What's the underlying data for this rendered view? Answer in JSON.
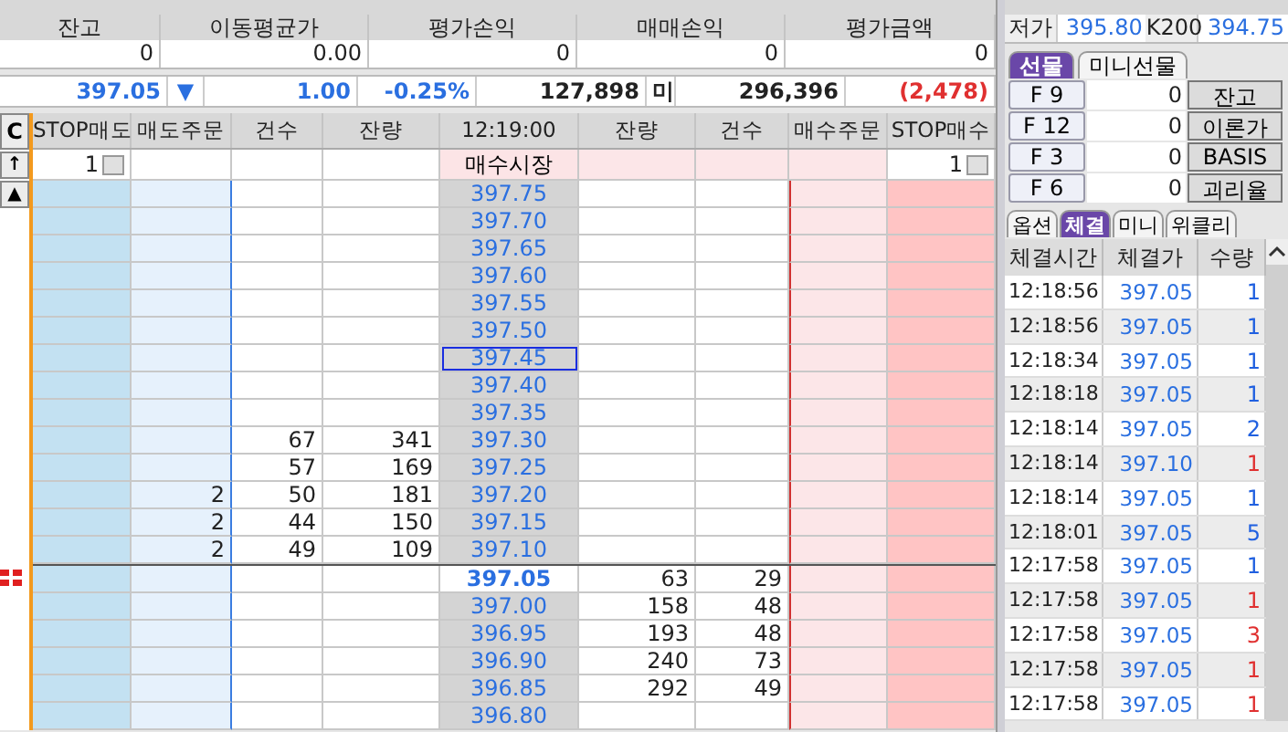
{
  "summary": {
    "headers": [
      "잔고",
      "이동평균가",
      "평가손익",
      "매매손익",
      "평가금액"
    ],
    "values": [
      "0",
      "0.00",
      "0",
      "0",
      "0"
    ]
  },
  "quote": {
    "price": "397.05",
    "direction": "▼",
    "change": "1.00",
    "rate": "-0.25%",
    "volume": "127,898",
    "label": "미",
    "open_interest": "296,396",
    "oi_change": "(2,478)"
  },
  "order_book": {
    "headers": [
      "C",
      "STOP매도",
      "매도주문",
      "건수",
      "잔량",
      "12:19:00",
      "잔량",
      "건수",
      "매수주문",
      "STOP매수"
    ],
    "market_row": {
      "button": "↑",
      "stop_sell": "1",
      "price": "매수시장",
      "stop_buy": "1"
    },
    "scroll_button": "▲",
    "rows": [
      {
        "price": "397.75",
        "selected": false,
        "current": false
      },
      {
        "price": "397.70",
        "selected": false,
        "current": false
      },
      {
        "price": "397.65",
        "selected": false,
        "current": false
      },
      {
        "price": "397.60",
        "selected": false,
        "current": false
      },
      {
        "price": "397.55",
        "selected": false,
        "current": false
      },
      {
        "price": "397.50",
        "selected": false,
        "current": false
      },
      {
        "price": "397.45",
        "selected": true,
        "current": false
      },
      {
        "price": "397.40",
        "selected": false,
        "current": false
      },
      {
        "price": "397.35",
        "selected": false,
        "current": false
      },
      {
        "sell_count": "67",
        "sell_qty": "341",
        "price": "397.30",
        "selected": false,
        "current": false
      },
      {
        "sell_count": "57",
        "sell_qty": "169",
        "price": "397.25",
        "selected": false,
        "current": false
      },
      {
        "sell_order": "2",
        "sell_count": "50",
        "sell_qty": "181",
        "price": "397.20",
        "selected": false,
        "current": false
      },
      {
        "sell_order": "2",
        "sell_count": "44",
        "sell_qty": "150",
        "price": "397.15",
        "selected": false,
        "current": false
      },
      {
        "sell_order": "2",
        "sell_count": "49",
        "sell_qty": "109",
        "price": "397.10",
        "selected": false,
        "current": false
      },
      {
        "price": "397.05",
        "buy_qty": "63",
        "buy_count": "29",
        "selected": false,
        "current": true
      },
      {
        "price": "397.00",
        "buy_qty": "158",
        "buy_count": "48",
        "selected": false,
        "current": false
      },
      {
        "price": "396.95",
        "buy_qty": "193",
        "buy_count": "48",
        "selected": false,
        "current": false
      },
      {
        "price": "396.90",
        "buy_qty": "240",
        "buy_count": "73",
        "selected": false,
        "current": false
      },
      {
        "price": "396.85",
        "buy_qty": "292",
        "buy_count": "49",
        "selected": false,
        "current": false
      },
      {
        "price": "396.80",
        "selected": false,
        "current": false
      }
    ]
  },
  "market_info": [
    {
      "label": "저가",
      "value": "395.80"
    },
    {
      "label": "K200",
      "value": "394.75"
    }
  ],
  "product_tabs": [
    {
      "label": "선물",
      "selected": true
    },
    {
      "label": "미니선물",
      "selected": false
    }
  ],
  "contracts": [
    {
      "code": "F 9",
      "value": "0",
      "button": "잔고"
    },
    {
      "code": "F 12",
      "value": "0",
      "button": "이론가"
    },
    {
      "code": "F 3",
      "value": "0",
      "button": "BASIS"
    },
    {
      "code": "F 6",
      "value": "0",
      "button": "괴리율"
    }
  ],
  "info_tabs": [
    {
      "label": "옵션",
      "selected": false
    },
    {
      "label": "체결",
      "selected": true
    },
    {
      "label": "미니",
      "selected": false
    },
    {
      "label": "위클리",
      "selected": false
    }
  ],
  "trades": {
    "columns": [
      "체결시간",
      "체결가",
      "수량"
    ],
    "rows": [
      {
        "time": "12:18:56",
        "price": "397.05",
        "qty": "1",
        "color": "#2060e0"
      },
      {
        "time": "12:18:56",
        "price": "397.05",
        "qty": "1",
        "color": "#2060e0"
      },
      {
        "time": "12:18:34",
        "price": "397.05",
        "qty": "1",
        "color": "#2060e0"
      },
      {
        "time": "12:18:18",
        "price": "397.05",
        "qty": "1",
        "color": "#2060e0"
      },
      {
        "time": "12:18:14",
        "price": "397.05",
        "qty": "2",
        "color": "#2060e0"
      },
      {
        "time": "12:18:14",
        "price": "397.10",
        "qty": "1",
        "color": "#e03030"
      },
      {
        "time": "12:18:14",
        "price": "397.05",
        "qty": "1",
        "color": "#2060e0"
      },
      {
        "time": "12:18:01",
        "price": "397.05",
        "qty": "5",
        "color": "#2060e0"
      },
      {
        "time": "12:17:58",
        "price": "397.05",
        "qty": "1",
        "color": "#2060e0"
      },
      {
        "time": "12:17:58",
        "price": "397.05",
        "qty": "1",
        "color": "#e03030"
      },
      {
        "time": "12:17:58",
        "price": "397.05",
        "qty": "3",
        "color": "#e03030"
      },
      {
        "time": "12:17:58",
        "price": "397.05",
        "qty": "1",
        "color": "#e03030"
      },
      {
        "time": "12:17:58",
        "price": "397.05",
        "qty": "1",
        "color": "#e03030"
      }
    ]
  }
}
